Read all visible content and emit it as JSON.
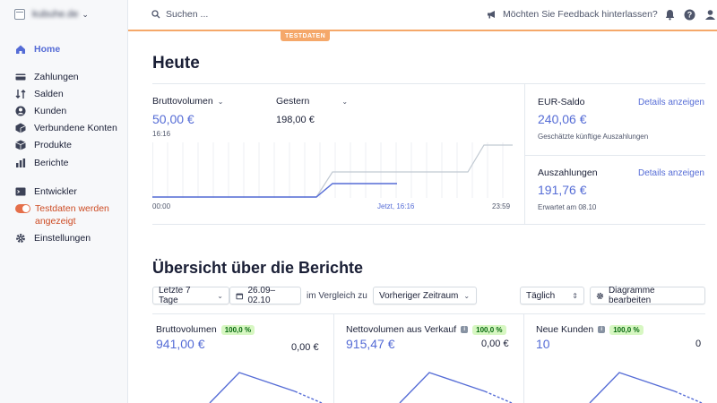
{
  "account": {
    "name": "kubuhe.de"
  },
  "sidebar": {
    "home": "Home",
    "items": [
      "Zahlungen",
      "Salden",
      "Kunden",
      "Verbundene Konten",
      "Produkte",
      "Berichte"
    ],
    "developer": "Entwickler",
    "testdata": "Testdaten werden angezeigt",
    "settings": "Einstellungen"
  },
  "topbar": {
    "search_placeholder": "Suchen ...",
    "feedback": "Möchten Sie Feedback hinterlassen?",
    "test_badge": "TESTDATEN"
  },
  "today": {
    "title": "Heute",
    "gross_label": "Bruttovolumen",
    "gross_value": "50,00 €",
    "gross_time": "16:16",
    "compare_label": "Gestern",
    "compare_value": "198,00 €",
    "axis_start": "00:00",
    "axis_now": "Jetzt, 16:16",
    "axis_end": "23:59",
    "eur_balance_label": "EUR-Saldo",
    "eur_balance_value": "240,06 €",
    "eur_balance_note": "Geschätzte künftige Auszahlungen",
    "payouts_label": "Auszahlungen",
    "payouts_value": "191,76 €",
    "payouts_note": "Erwartet am 08.10",
    "details_link": "Details anzeigen"
  },
  "reports": {
    "title": "Übersicht über die Berichte",
    "range": "Letzte 7 Tage",
    "dates": "26.09–02.10",
    "compare_text": "im Vergleich zu",
    "compare_select": "Vorheriger Zeitraum",
    "interval": "Täglich",
    "edit_charts": "Diagramme bearbeiten",
    "cards": [
      {
        "title": "Bruttovolumen",
        "pct": "100,0 %",
        "value": "941,00 €",
        "compare": "0,00 €"
      },
      {
        "title": "Nettovolumen aus Verkauf",
        "pct": "100,0 %",
        "value": "915,47 €",
        "compare": "0,00 €"
      },
      {
        "title": "Neue Kunden",
        "pct": "100,0 %",
        "value": "10",
        "compare": "0"
      }
    ]
  },
  "colors": {
    "accent": "#556cd6",
    "test": "#f5a86a",
    "warn": "#cd4b23"
  }
}
